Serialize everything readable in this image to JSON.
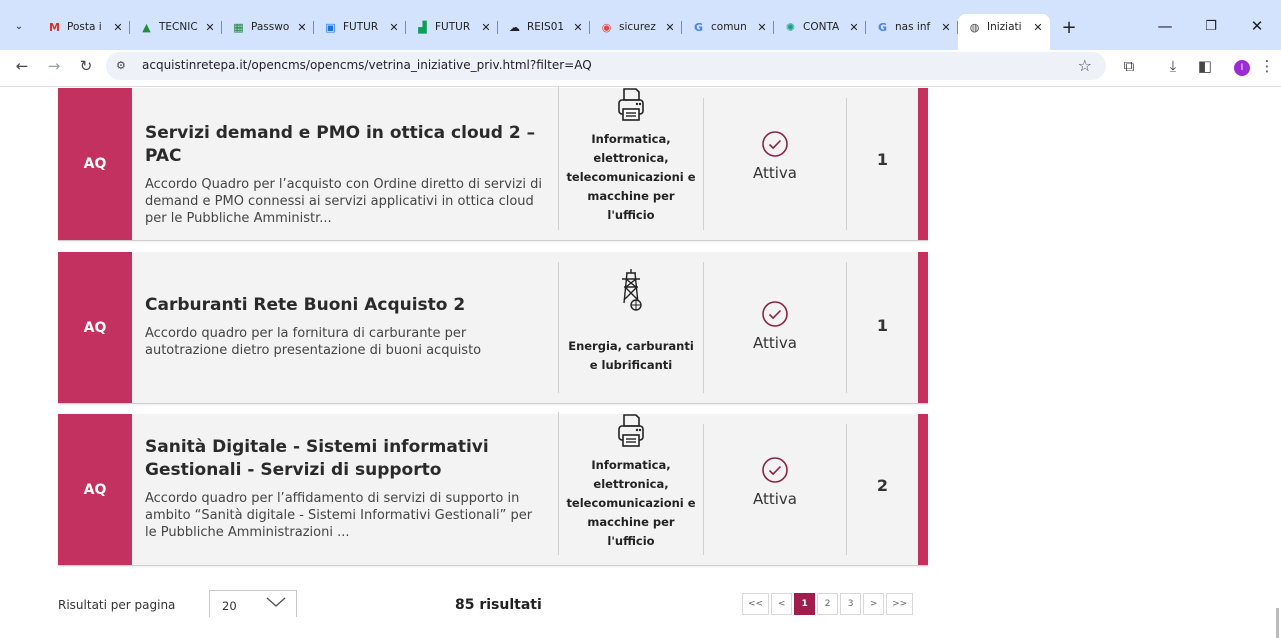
{
  "browser": {
    "tabs": [
      {
        "label": "Posta i",
        "favicon": "gmail-icon",
        "color": "#d93025",
        "glyph": "M"
      },
      {
        "label": "TECNIC",
        "favicon": "drive-icon",
        "color": "#1e8e3e",
        "glyph": "▲"
      },
      {
        "label": "Passwo",
        "favicon": "sheets-icon",
        "color": "#188038",
        "glyph": "▦"
      },
      {
        "label": "FUTUR",
        "favicon": "app-icon",
        "color": "#1a73e8",
        "glyph": "▣"
      },
      {
        "label": "FUTUR",
        "favicon": "chart-icon",
        "color": "#0f9d58",
        "glyph": "▟"
      },
      {
        "label": "REIS01",
        "favicon": "cloud-icon",
        "color": "#202124",
        "glyph": "☁"
      },
      {
        "label": "sicurez",
        "favicon": "copilot-icon",
        "color": "#e8453c",
        "glyph": "◉"
      },
      {
        "label": "comun",
        "favicon": "google-icon",
        "color": "#4285f4",
        "glyph": "G"
      },
      {
        "label": "CONTA",
        "favicon": "chatgpt-icon",
        "color": "#10a37f",
        "glyph": "✺"
      },
      {
        "label": "nas inf",
        "favicon": "google-icon",
        "color": "#4285f4",
        "glyph": "G"
      }
    ],
    "active_tab": {
      "label": "Iniziati",
      "favicon": "globe-icon"
    },
    "close_glyph": "✕",
    "new_tab_glyph": "+",
    "url": "acquistinretepa.it/opencms/opencms/vetrina_iniziative_priv.html?filter=AQ",
    "profile_initial": "I"
  },
  "cards": [
    {
      "badge": "AQ",
      "title": "Servizi demand e PMO in ottica cloud 2 – PAC",
      "description": "Accordo Quadro per l’acquisto con Ordine diretto di servizi di demand e PMO connessi ai servizi applicativi in ottica cloud per le Pubbliche Amministr...",
      "category_icon": "printer-icon",
      "category_lines": [
        "Informatica,",
        "elettronica,",
        "telecomunicazioni e",
        "macchine per",
        "l'ufficio"
      ],
      "status": "Attiva",
      "count": "1"
    },
    {
      "badge": "AQ",
      "title": "Carburanti Rete Buoni Acquisto 2",
      "description": "Accordo quadro per la fornitura di carburante per autotrazione dietro presentazione di buoni acquisto",
      "category_icon": "energy-tower-icon",
      "category_lines": [
        "Energia, carburanti",
        "e lubrificanti"
      ],
      "status": "Attiva",
      "count": "1"
    },
    {
      "badge": "AQ",
      "title": "Sanità Digitale - Sistemi informativi Gestionali - Servizi di supporto",
      "description": "Accordo quadro per l’affidamento di servizi di supporto in ambito “Sanità digitale - Sistemi Informativi Gestionali” per le Pubbliche Amministrazioni ...",
      "category_icon": "printer-icon",
      "category_lines": [
        "Informatica,",
        "elettronica,",
        "telecomunicazioni e",
        "macchine per",
        "l'ufficio"
      ],
      "status": "Attiva",
      "count": "2"
    }
  ],
  "footer": {
    "rpp_label": "Risultati per pagina",
    "rpp_value": "20",
    "results": "85 risultati",
    "pages": [
      "<<",
      "<",
      "1",
      "2",
      "3",
      ">",
      ">>"
    ],
    "active_page": "1"
  },
  "colors": {
    "accent": "#c2315f",
    "pager_active": "#a01e4d",
    "status_icon": "#8b2346"
  }
}
